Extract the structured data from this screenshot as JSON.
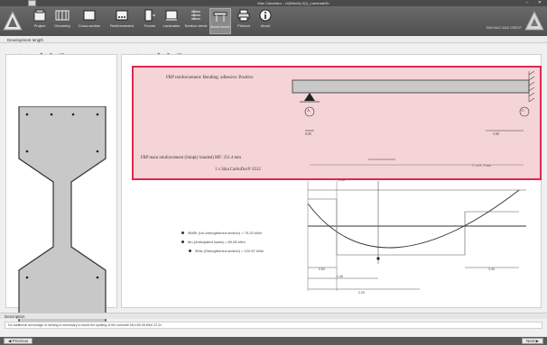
{
  "window": {
    "title": "Mac Calculator - v2(Beta3)-2(1)_Laminate2b",
    "controls": [
      "–",
      "✕"
    ]
  },
  "ribbon": {
    "items": [
      {
        "key": "project",
        "label": "Project",
        "icon": "project-icon"
      },
      {
        "key": "geometry",
        "label": "Geometry",
        "icon": "geometry-icon"
      },
      {
        "key": "cross-section",
        "label": "Cross-section",
        "icon": "cross-section-icon"
      },
      {
        "key": "reinforcement",
        "label": "Reinforcement",
        "icon": "reinforcement-icon"
      },
      {
        "key": "forces",
        "label": "Forces",
        "icon": "forces-icon"
      },
      {
        "key": "laminates",
        "label": "Laminates",
        "icon": "laminates-icon"
      },
      {
        "key": "section-check",
        "label": "Section check",
        "icon": "section-check-icon"
      },
      {
        "key": "bond-check",
        "label": "Bond check",
        "icon": "bond-check-icon"
      },
      {
        "key": "printout",
        "label": "Printout",
        "icon": "printer-icon"
      },
      {
        "key": "about",
        "label": "About",
        "icon": "info-icon"
      }
    ],
    "active": "bond-check",
    "status_text": "SIKA MAC WAS CREDIT"
  },
  "section_header": "Development length",
  "popup": {
    "line1": "FRP reinforcement: Bending: adhesive: Positive",
    "line2": "FRP main reinforcement (Simply bonded) MF: 231.4 mm",
    "line3": "1 x Sika CarboDur® S512",
    "support_left": "A",
    "support_right": "C",
    "dim_left": "0.00",
    "dim_right": "5.00",
    "dim_bottom": "2.33",
    "dim_span": "1. 4.41, 3 mm"
  },
  "legend": [
    "ΦMRr (Un-strengthened section) = 79.25 kNm",
    "Mu (Anticipated loads) = 89.28 kNm",
    "ΦMs (Strengthened section) = 120.67 kNm"
  ],
  "diagram_dims": {
    "top": "2.43",
    "d1": "0.83",
    "d2": "1.46",
    "d3": "2.29",
    "d4": "3.35"
  },
  "description": {
    "header": "Description",
    "text": "No additional anchorage or lashing is necessary to avoid the spalling of the concrete MU=89.28 kNm 22.2x"
  },
  "footer": {
    "previous": "◀ Previous",
    "next": "Next ▶"
  }
}
